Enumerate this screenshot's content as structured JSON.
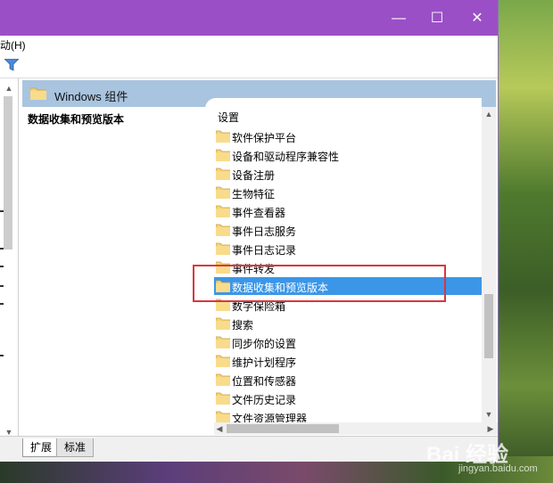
{
  "window": {
    "menu": {
      "help_label": "动(H)"
    },
    "controls": {
      "minimize": "—",
      "maximize": "☐",
      "close": "✕"
    }
  },
  "pane": {
    "header_title": "Windows 组件",
    "left_title": "数据收集和预览版本",
    "settings_label": "设置",
    "items": [
      {
        "label": "软件保护平台",
        "selected": false
      },
      {
        "label": "设备和驱动程序兼容性",
        "selected": false
      },
      {
        "label": "设备注册",
        "selected": false
      },
      {
        "label": "生物特征",
        "selected": false
      },
      {
        "label": "事件查看器",
        "selected": false
      },
      {
        "label": "事件日志服务",
        "selected": false
      },
      {
        "label": "事件日志记录",
        "selected": false
      },
      {
        "label": "事件转发",
        "selected": false
      },
      {
        "label": "数据收集和预览版本",
        "selected": true
      },
      {
        "label": "数字保险箱",
        "selected": false
      },
      {
        "label": "搜索",
        "selected": false
      },
      {
        "label": "同步你的设置",
        "selected": false
      },
      {
        "label": "维护计划程序",
        "selected": false
      },
      {
        "label": "位置和传感器",
        "selected": false
      },
      {
        "label": "文件历史记录",
        "selected": false
      },
      {
        "label": "文件资源管理器",
        "selected": false
      }
    ]
  },
  "tabs": [
    {
      "label": "扩展",
      "active": true
    },
    {
      "label": "标准",
      "active": false
    }
  ],
  "colors": {
    "titlebar": "#9b4fc6",
    "header": "#a9c4df",
    "selection": "#3b96e8",
    "highlight_box": "#d9363e"
  },
  "watermark": {
    "main": "Bai 经验",
    "sub": "jingyan.baidu.com"
  }
}
